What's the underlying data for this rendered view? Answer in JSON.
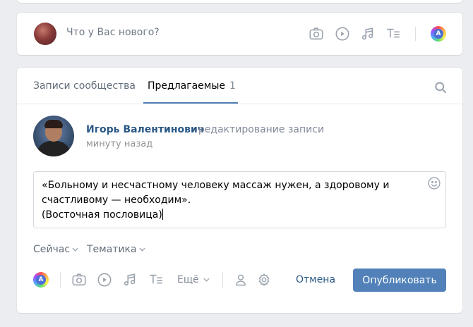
{
  "composer": {
    "placeholder": "Что у Вас нового?",
    "icons": [
      "camera-icon",
      "video-icon",
      "music-icon",
      "text-format-icon",
      "avatar-badge-icon"
    ],
    "badge_letter": "A"
  },
  "tabs": [
    {
      "label": "Записи сообщества",
      "count": ""
    },
    {
      "label": "Предлагаемые",
      "count": "1",
      "active": true
    }
  ],
  "post": {
    "author": "Игорь Валентинович",
    "action": "· редактирование записи",
    "time": "минуту назад",
    "text": "«Больному и несчастному человеку массаж нужен, а здоровому и\nсчастливому — необходим».\n(Восточная пословица)"
  },
  "options": {
    "when": "Сейчас",
    "topic": "Тематика"
  },
  "toolbar": {
    "badge_letter": "A",
    "more": "Ещё",
    "cancel": "Отмена",
    "publish": "Опубликовать"
  },
  "colors": {
    "accent": "#5181b8",
    "link": "#2a5885",
    "muted": "#828a99",
    "background": "#ebedf0"
  }
}
